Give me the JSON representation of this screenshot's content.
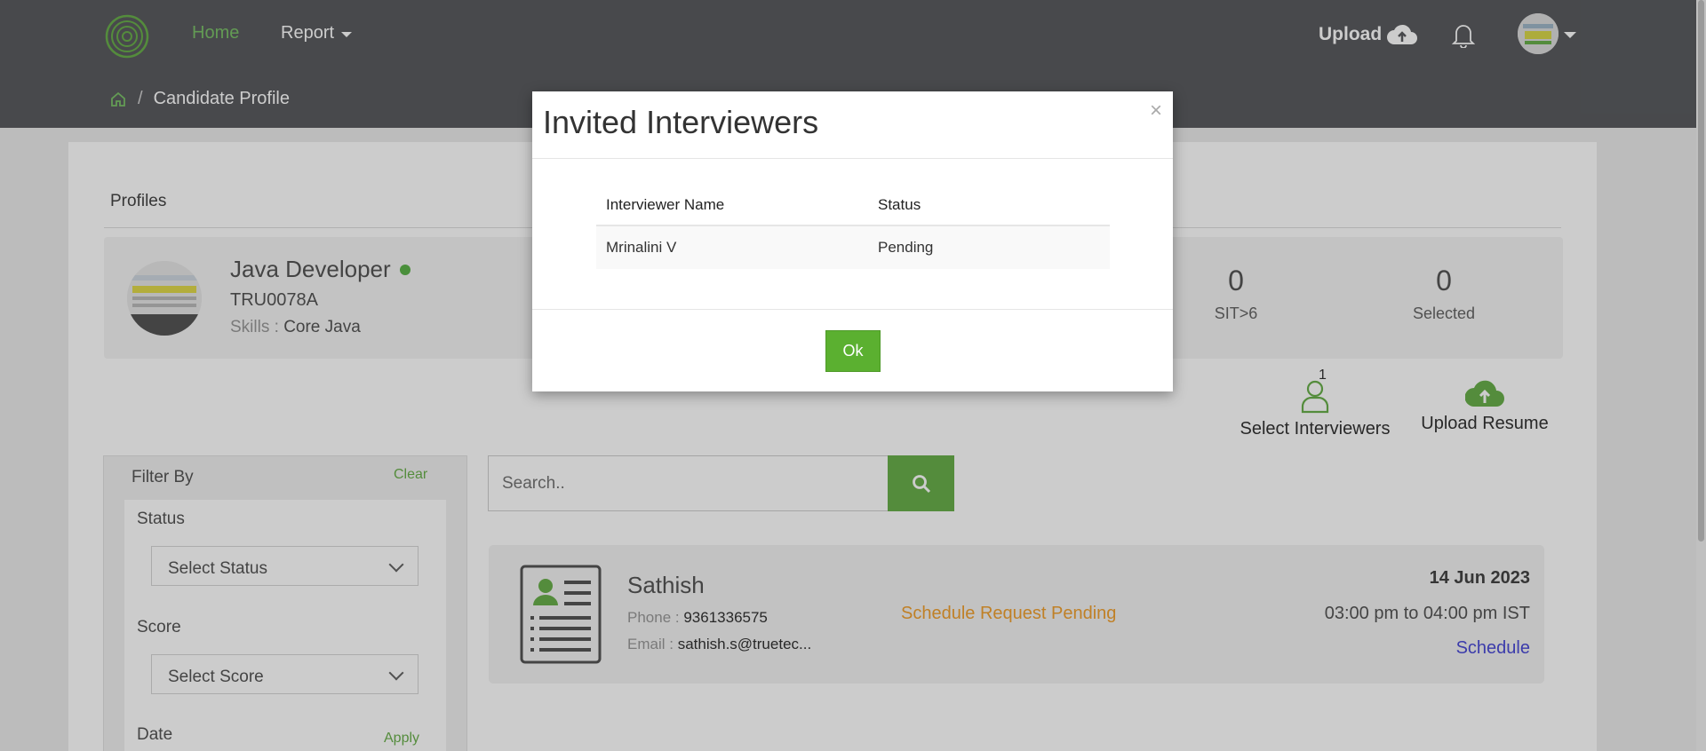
{
  "nav": {
    "home": "Home",
    "report": "Report",
    "upload": "Upload"
  },
  "breadcrumb": {
    "page": "Candidate Profile"
  },
  "profiles": {
    "title": "Profiles",
    "job_title": "Java Developer",
    "job_code": "TRU0078A",
    "skills_label": "Skills :",
    "skills_value": "Core Java",
    "stats": [
      {
        "value": "0",
        "label": "SIT>6"
      },
      {
        "value": "0",
        "label": "Selected"
      }
    ],
    "actions": {
      "select_interviewers": "Select Interviewers",
      "interviewers_badge": "1",
      "upload_resume": "Upload Resume"
    }
  },
  "filter": {
    "title": "Filter By",
    "clear": "Clear",
    "status_label": "Status",
    "status_select": "Select Status",
    "score_label": "Score",
    "score_select": "Select Score",
    "date_label": "Date",
    "apply": "Apply"
  },
  "search": {
    "placeholder": "Search.."
  },
  "candidate": {
    "name": "Sathish",
    "phone_label": "Phone :",
    "phone": "9361336575",
    "email_label": "Email :",
    "email": "sathish.s@truetec...",
    "status": "Schedule Request Pending",
    "date": "14 Jun 2023",
    "time": "03:00 pm to 04:00 pm IST",
    "schedule_link": "Schedule"
  },
  "modal": {
    "title": "Invited Interviewers",
    "close": "×",
    "columns": [
      "Interviewer Name",
      "Status"
    ],
    "rows": [
      {
        "name": "Mrinalini V",
        "status": "Pending"
      }
    ],
    "ok": "Ok"
  },
  "colors": {
    "accent_green": "#6ab04c",
    "status_orange": "#f0a030",
    "link_blue": "#4b4bd6",
    "navbar": "#5a5c60"
  }
}
